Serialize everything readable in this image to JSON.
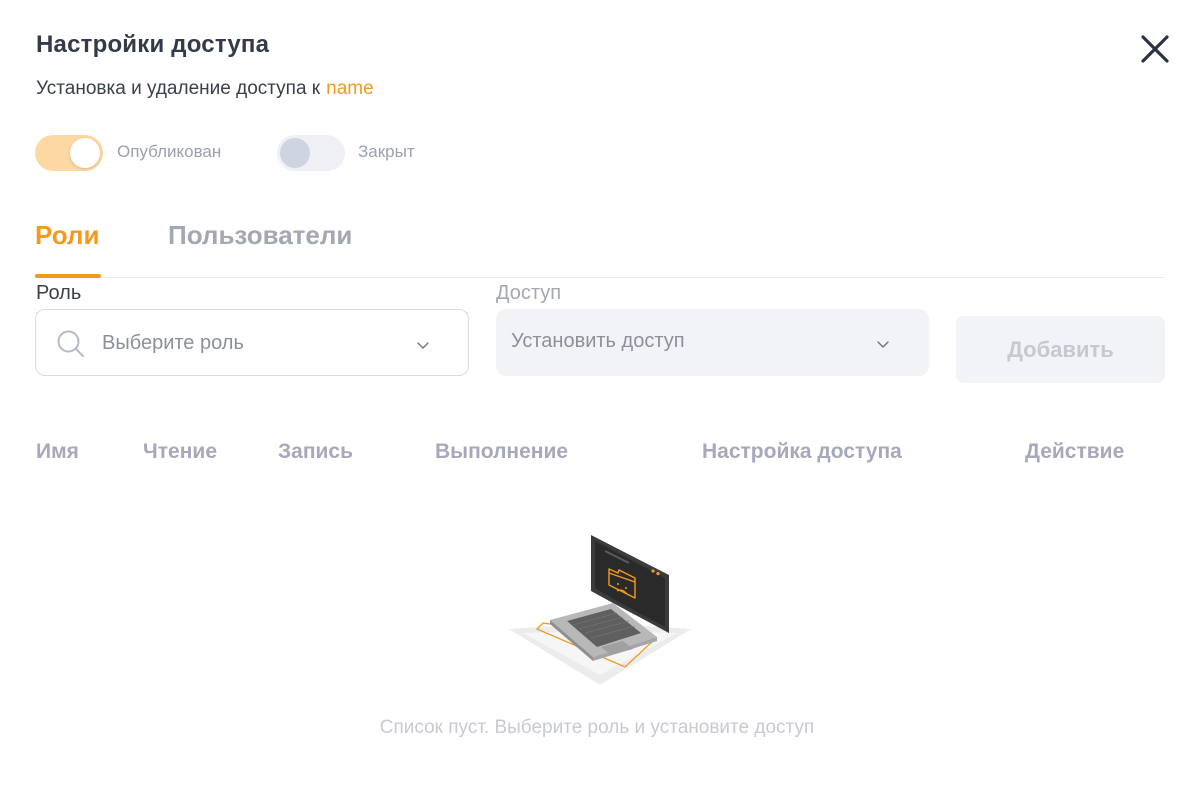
{
  "header": {
    "title": "Настройки доступа",
    "subtitle_prefix": "Установка и удаление доступа к",
    "subtitle_target": "name",
    "close_icon": "close-icon"
  },
  "toggles": [
    {
      "label": "Опубликован",
      "state": true
    },
    {
      "label": "Закрыт",
      "state": false
    }
  ],
  "tabs": [
    {
      "label": "Роли",
      "active": true
    },
    {
      "label": "Пользователи",
      "active": false
    }
  ],
  "form": {
    "role_label": "Роль",
    "role_placeholder": "Выберите роль",
    "access_label": "Доступ",
    "access_value": "Установить доступ",
    "add_button": "Добавить"
  },
  "table": {
    "columns": [
      "Имя",
      "Чтение",
      "Запись",
      "Выполнение",
      "Настройка доступа",
      "Действие"
    ],
    "empty_text": "Список пуст. Выберите роль и установите доступ",
    "empty_icon": "laptop-empty-folder-icon"
  },
  "colors": {
    "accent": "#f29a1f",
    "toggle_on_track": "#fcd9a2",
    "toggle_off_track": "#eef0f4",
    "toggle_off_knob": "#cfd5e0",
    "text_dark": "#343a48",
    "text_muted": "#a4a8b2"
  }
}
